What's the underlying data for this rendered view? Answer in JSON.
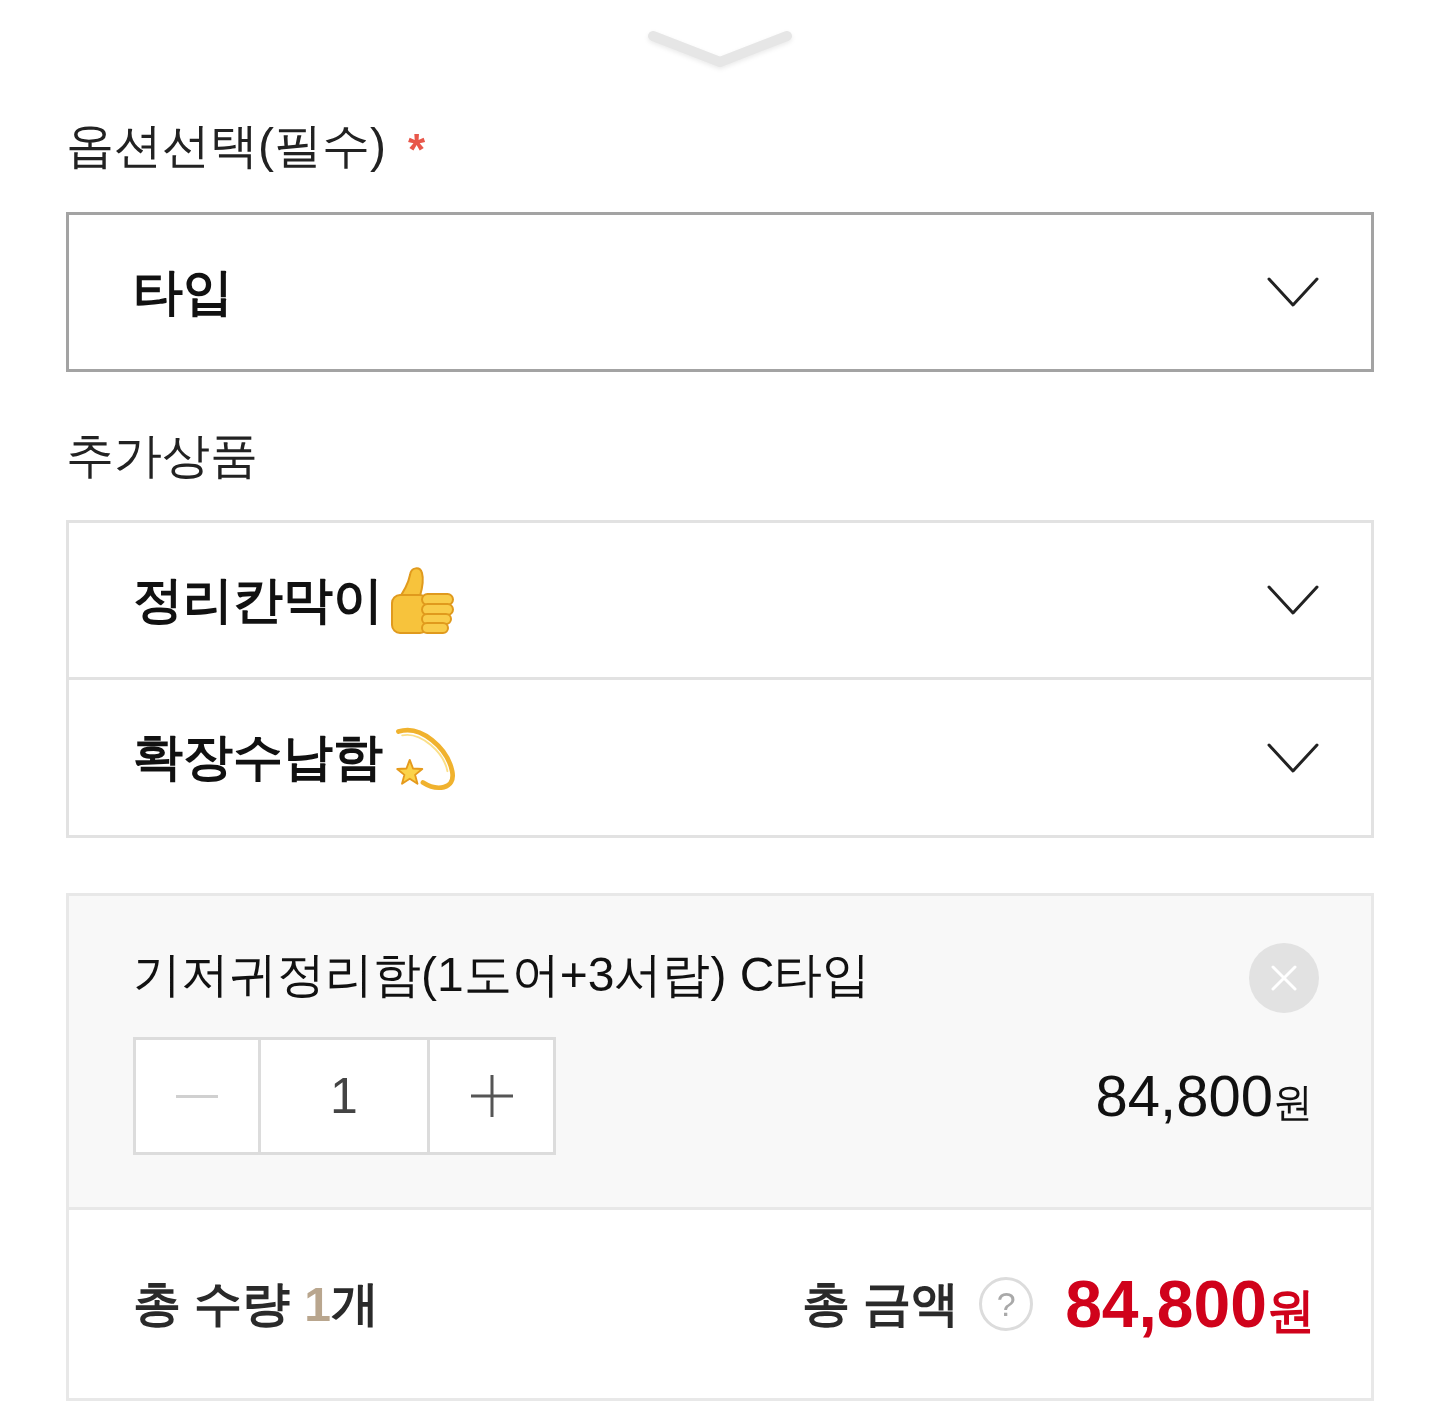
{
  "option_section": {
    "label": "옵션선택(필수)",
    "required_mark": "*",
    "dropdown": {
      "label": "타입"
    }
  },
  "addon_section": {
    "label": "추가상품",
    "dropdowns": [
      {
        "label": "정리칸막이"
      },
      {
        "label": "확장수납함"
      }
    ]
  },
  "selected_items": [
    {
      "name": "기저귀정리함(1도어+3서랍) C타입",
      "quantity": "1",
      "decrease_disabled": true,
      "price": "84,800",
      "currency": "원"
    }
  ],
  "summary": {
    "quantity_label": "총 수량",
    "quantity_value": "1",
    "quantity_unit": "개",
    "amount_label": "총 금액",
    "help": "?",
    "total": "84,800",
    "currency": "원"
  }
}
